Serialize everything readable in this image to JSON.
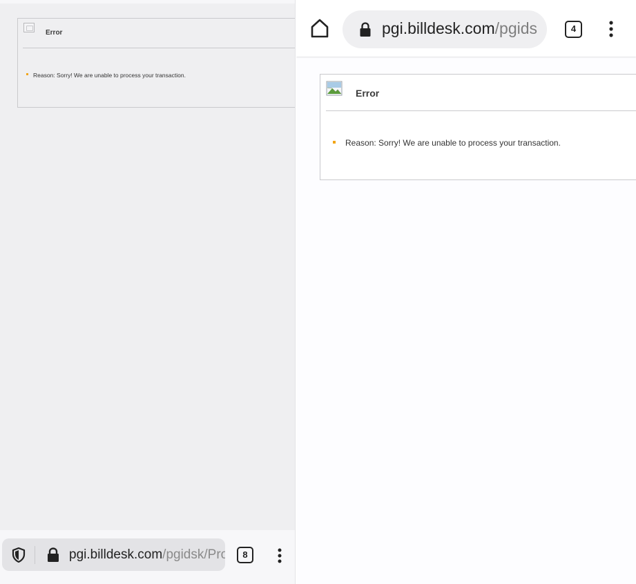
{
  "left_window": {
    "error_panel": {
      "title": "Error",
      "reason": "Reason: Sorry! We are unable to process your transaction."
    },
    "toolbar": {
      "url_host": "pgi.billdesk.com",
      "url_path": "/pgidsk/Pro",
      "tab_count": "8"
    }
  },
  "right_window": {
    "toolbar": {
      "url_host": "pgi.billdesk.com",
      "url_path": "/pgids",
      "tab_count": "4"
    },
    "error_panel": {
      "title": "Error",
      "reason": "Reason: Sorry! We are unable to process your transaction."
    }
  },
  "colors": {
    "bullet": "#f2a516",
    "panel_border": "#c9c9cc",
    "left_background": "#efeff1",
    "right_background": "#fdfdff"
  },
  "icons": [
    "shield-icon",
    "lock-icon",
    "home-icon",
    "more-vert-icon",
    "broken-image-icon"
  ]
}
